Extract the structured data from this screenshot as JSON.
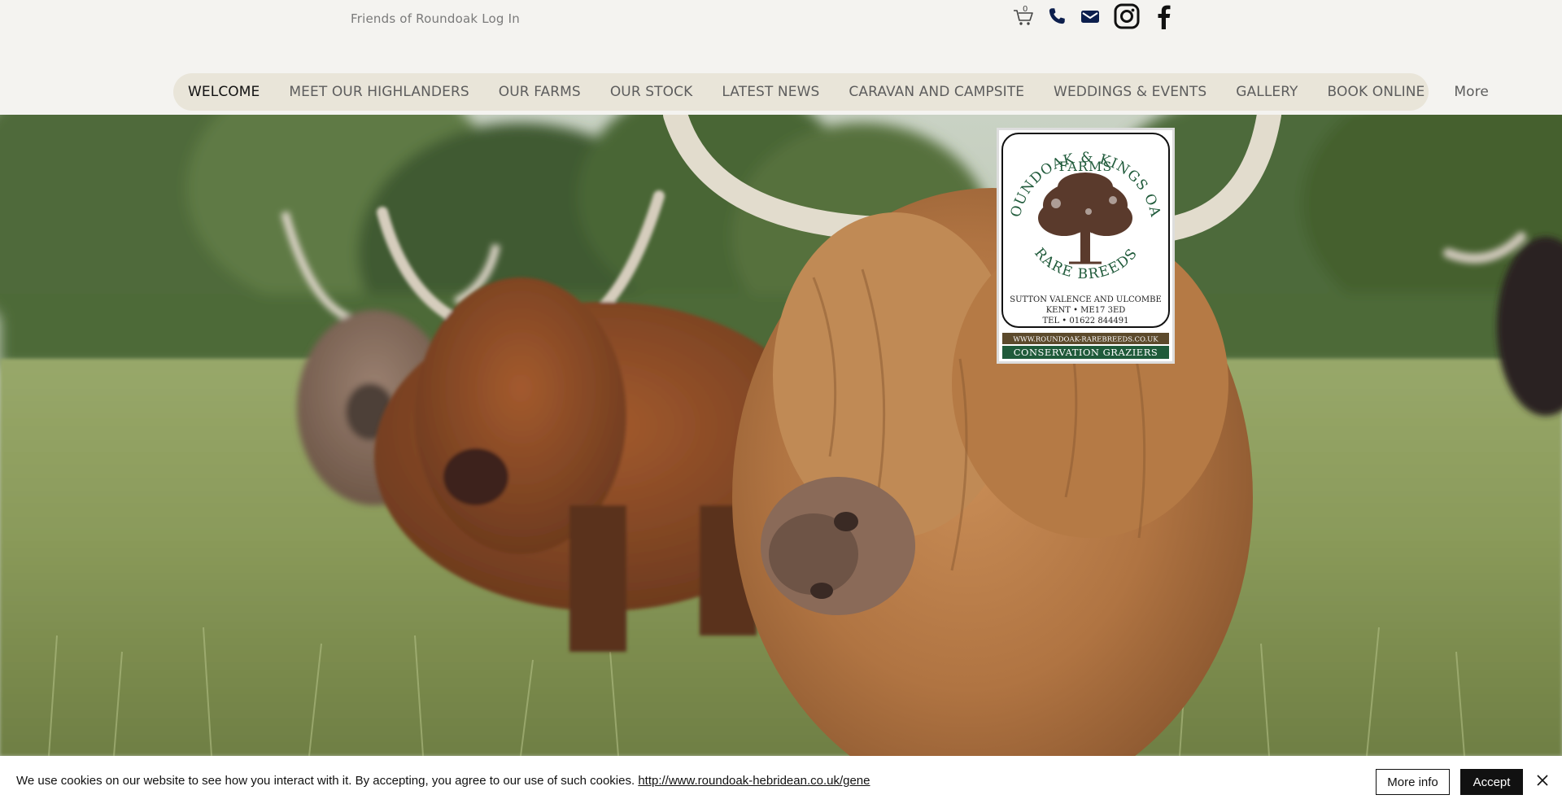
{
  "header": {
    "login_text": "Friends of Roundoak Log In",
    "cart_count": "0",
    "icons": [
      "cart-icon",
      "phone-icon",
      "mail-icon",
      "instagram-icon",
      "facebook-icon"
    ]
  },
  "nav": {
    "items": [
      {
        "label": "WELCOME",
        "active": true
      },
      {
        "label": "MEET OUR HIGHLANDERS"
      },
      {
        "label": "OUR FARMS"
      },
      {
        "label": "OUR STOCK"
      },
      {
        "label": "LATEST NEWS"
      },
      {
        "label": "CARAVAN AND CAMPSITE"
      },
      {
        "label": "WEDDINGS & EVENTS"
      },
      {
        "label": "GALLERY"
      },
      {
        "label": "BOOK ONLINE"
      },
      {
        "label": "More"
      }
    ]
  },
  "logo": {
    "arc_top": "ROUNDOAK & KINGS OAK",
    "line_farms": "FARMS",
    "arc_bottom": "RARE BREEDS",
    "address_1": "SUTTON VALENCE AND ULCOMBE",
    "address_2": "KENT • ME17 3ED",
    "tel": "TEL • 01622 844491",
    "website": "WWW.ROUNDOAK-RAREBREEDS.CO.UK",
    "tagline": "CONSERVATION GRAZIERS"
  },
  "cookie": {
    "message": "We use cookies on our website to see how you interact with it. By accepting, you agree to our use of such cookies.",
    "link_text": "http://www.roundoak-hebridean.co.uk/gene",
    "more_info_label": "More info",
    "accept_label": "Accept"
  },
  "colors": {
    "nav_bg": "#e9e5d9",
    "logo_green": "#1f5a3a",
    "logo_brown": "#5a3a2c",
    "accent_dark": "#111111"
  }
}
